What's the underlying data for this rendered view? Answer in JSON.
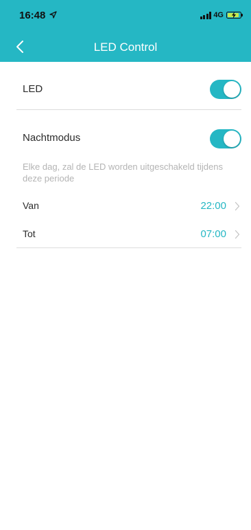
{
  "status_bar": {
    "time": "16:48",
    "network": "4G",
    "battery_level": 0.9,
    "colors": {
      "background": "#25b7c4",
      "battery_fill": "#c7e94f"
    }
  },
  "nav": {
    "title": "LED Control",
    "back_icon": "chevron-left-icon"
  },
  "led": {
    "label": "LED",
    "enabled": true
  },
  "night_mode": {
    "label": "Nachtmodus",
    "enabled": true,
    "description": "Elke dag, zal de LED worden uitgeschakeld tijdens deze periode",
    "from": {
      "label": "Van",
      "value": "22:00"
    },
    "to": {
      "label": "Tot",
      "value": "07:00"
    }
  },
  "colors": {
    "accent": "#25b7c4",
    "text": "#2b2b2b",
    "muted": "#b4b4b4",
    "divider": "#dcdcdc"
  }
}
